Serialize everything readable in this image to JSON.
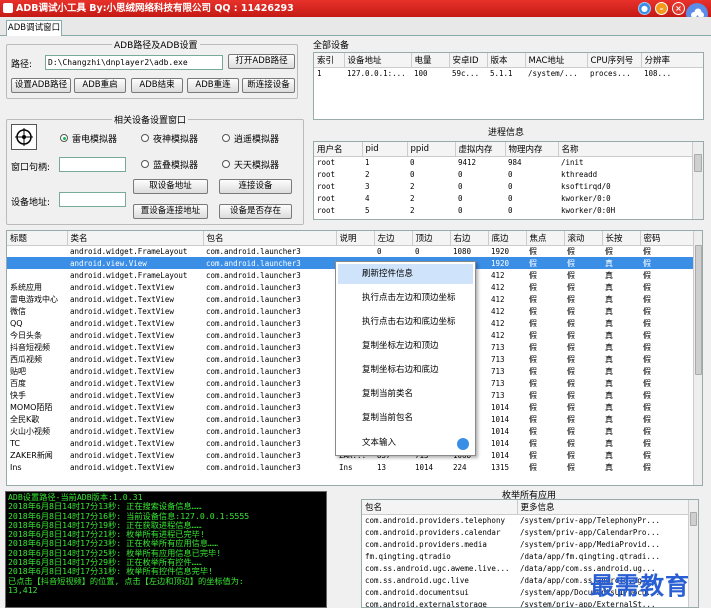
{
  "app": {
    "title": "ADB调试小工具  By:小思绒网络科技有限公司  QQ : 11426293"
  },
  "tabs": [
    "ADB调试窗口"
  ],
  "adb_path": {
    "group_label": "ADB路径及ADB设置",
    "path_label": "路径:",
    "path_value": "D:\\Changzhi\\dnplayer2\\adb.exe",
    "open_button": "打开ADB路径",
    "buttons": [
      "设置ADB路径",
      "ADB重启",
      "ADB结束",
      "ADB重连",
      "断连接设备"
    ]
  },
  "device_settings": {
    "group_label": "相关设备设置窗口",
    "emulators": [
      "雷电模拟器",
      "夜神模拟器",
      "逍遥模拟器",
      "蓝叠模拟器",
      "天天模拟器"
    ],
    "selected_emulator": "雷电模拟器",
    "handle_label": "窗口句柄:",
    "handle_value": "",
    "address_label": "设备地址:",
    "address_value": "",
    "buttons": [
      "取设备地址",
      "连接设备",
      "置设备连接地址",
      "设备是否存在"
    ]
  },
  "all_devices": {
    "group_label": "全部设备",
    "columns": [
      "索引",
      "设备地址",
      "电量",
      "安卓ID",
      "版本",
      "MAC地址",
      "CPU序列号",
      "分辨率"
    ],
    "rows": [
      [
        "1",
        "127.0.0.1:...",
        "100",
        "59c...",
        "5.1.1",
        "/system/...",
        "proces...",
        "108..."
      ]
    ]
  },
  "processes": {
    "group_label": "进程信息",
    "columns": [
      "用户名",
      "pid",
      "ppid",
      "虚拟内存",
      "物理内存",
      "名称"
    ],
    "rows": [
      [
        "root",
        "1",
        "0",
        "9412",
        "984",
        "/init"
      ],
      [
        "root",
        "2",
        "0",
        "0",
        "0",
        "kthreadd"
      ],
      [
        "root",
        "3",
        "2",
        "0",
        "0",
        "ksoftirqd/0"
      ],
      [
        "root",
        "4",
        "2",
        "0",
        "0",
        "kworker/0:0"
      ],
      [
        "root",
        "5",
        "2",
        "0",
        "0",
        "kworker/0:0H"
      ]
    ]
  },
  "controls": {
    "columns": [
      "标题",
      "类名",
      "包名",
      "说明",
      "左边",
      "顶边",
      "右边",
      "底边",
      "焦点",
      "滚动",
      "长按",
      "密码"
    ],
    "selected_index": 1,
    "rows": [
      [
        "",
        "android.widget.FrameLayout",
        "com.android.launcher3",
        "",
        "0",
        "0",
        "1080",
        "1920",
        "假",
        "假",
        "假",
        "假"
      ],
      [
        "",
        "android.view.View",
        "com.android.launcher3",
        "",
        "",
        "",
        "",
        "1920",
        "假",
        "假",
        "真",
        "假"
      ],
      [
        "",
        "android.widget.FrameLayout",
        "com.android.launcher3",
        "",
        "",
        "",
        "",
        "412",
        "假",
        "假",
        "真",
        "假"
      ],
      [
        "系统应用",
        "android.widget.TextView",
        "com.android.launcher3",
        "",
        "",
        "",
        "",
        "412",
        "假",
        "假",
        "真",
        "假"
      ],
      [
        "雷电游戏中心",
        "android.widget.TextView",
        "com.android.launcher3",
        "",
        "",
        "",
        "",
        "412",
        "假",
        "假",
        "真",
        "假"
      ],
      [
        "微信",
        "android.widget.TextView",
        "com.android.launcher3",
        "",
        "",
        "",
        "",
        "412",
        "假",
        "假",
        "真",
        "假"
      ],
      [
        "QQ",
        "android.widget.TextView",
        "com.android.launcher3",
        "",
        "",
        "",
        "",
        "412",
        "假",
        "假",
        "真",
        "假"
      ],
      [
        "今日头条",
        "android.widget.TextView",
        "com.android.launcher3",
        "",
        "",
        "",
        "",
        "412",
        "假",
        "假",
        "真",
        "假"
      ],
      [
        "抖音短视频",
        "android.widget.TextView",
        "com.android.launcher3",
        "",
        "",
        "",
        "",
        "713",
        "假",
        "假",
        "真",
        "假"
      ],
      [
        "西瓜视频",
        "android.widget.TextView",
        "com.android.launcher3",
        "",
        "",
        "",
        "",
        "713",
        "假",
        "假",
        "真",
        "假"
      ],
      [
        "贴吧",
        "android.widget.TextView",
        "com.android.launcher3",
        "",
        "",
        "",
        "",
        "713",
        "假",
        "假",
        "真",
        "假"
      ],
      [
        "百度",
        "android.widget.TextView",
        "com.android.launcher3",
        "",
        "",
        "",
        "",
        "713",
        "假",
        "假",
        "真",
        "假"
      ],
      [
        "快手",
        "android.widget.TextView",
        "com.android.launcher3",
        "",
        "",
        "",
        "",
        "713",
        "假",
        "假",
        "真",
        "假"
      ],
      [
        "MOMO陌陌",
        "android.widget.TextView",
        "com.android.launcher3",
        "",
        "",
        "",
        "",
        "1014",
        "假",
        "假",
        "真",
        "假"
      ],
      [
        "全民K歌",
        "android.widget.TextView",
        "com.android.launcher3",
        "",
        "",
        "",
        "",
        "1014",
        "假",
        "假",
        "真",
        "假"
      ],
      [
        "火山小视频",
        "android.widget.TextView",
        "com.android.launcher3",
        "",
        "",
        "",
        "",
        "1014",
        "假",
        "假",
        "真",
        "假"
      ],
      [
        "TC",
        "android.widget.TextView",
        "com.android.launcher3",
        "",
        "",
        "",
        "",
        "1014",
        "假",
        "假",
        "真",
        "假"
      ],
      [
        "ZAKER新闻",
        "android.widget.TextView",
        "com.android.launcher3",
        "ZAK...",
        "857",
        "713",
        "1068",
        "1014",
        "假",
        "假",
        "真",
        "假"
      ],
      [
        "Ins",
        "android.widget.TextView",
        "com.android.launcher3",
        "Ins",
        "13",
        "1014",
        "224",
        "1315",
        "假",
        "假",
        "真",
        "假"
      ]
    ]
  },
  "context_menu": {
    "items": [
      "刷新控件信息",
      "执行点击左边和顶边坐标",
      "执行点击右边和底边坐标",
      "复制坐标左边和顶边",
      "复制坐标右边和底边",
      "复制当前类名",
      "复制当前包名",
      "文本输入"
    ],
    "highlighted": 0
  },
  "log": {
    "lines": [
      "ADB设置路径-当前ADB版本:1.0.31",
      "2018年6月8日14时17分13秒: 正在搜索设备信息……",
      "2018年6月8日14时17分16秒: 当前设备信息:127.0.0.1:5555",
      "2018年6月8日14时17分19秒: 正在获取进程信息……",
      "2018年6月8日14时17分21秒: 枚举所有进程已完毕!",
      "2018年6月8日14时17分23秒: 正在枚举所有应用信息……",
      "2018年6月8日14时17分25秒: 枚举所有应用信息已完毕!",
      "2018年6月8日14时17分29秒: 正在枚举所有控件……",
      "2018年6月8日14时17分31秒: 枚举所有控件信息完毕!",
      "已点击【抖音短视频】的位置, 点击【左边和顶边】的坐标值为:",
      "13,412"
    ]
  },
  "apps": {
    "group_label": "枚举所有应用",
    "columns": [
      "包名",
      "更多信息"
    ],
    "rows": [
      [
        "com.android.providers.telephony",
        "/system/priv-app/TelephonyPr..."
      ],
      [
        "com.android.providers.calendar",
        "/system/priv-app/CalendarPro..."
      ],
      [
        "com.android.providers.media",
        "/system/priv-app/MediaProvid..."
      ],
      [
        "fm.qingting.qtradio",
        "/data/app/fm.qingting.qtradi..."
      ],
      [
        "com.ss.android.ugc.aweme.live...",
        "/data/app/com.ss.android.ug..."
      ],
      [
        "com.ss.android.ugc.live",
        "/data/app/com.ss.android.ug..."
      ],
      [
        "com.android.documentsui",
        "/system/app/DocumentsUI/Docu..."
      ],
      [
        "com.android.externalstorage",
        "/system/priv-app/ExternalSt..."
      ]
    ]
  },
  "watermark": "最需教育",
  "colors": {
    "titlebar": "#d9261f",
    "selection": "#3a8ee6",
    "log_bg": "#000000",
    "log_text": "#39e834",
    "watermark": "#2a5fd4"
  }
}
